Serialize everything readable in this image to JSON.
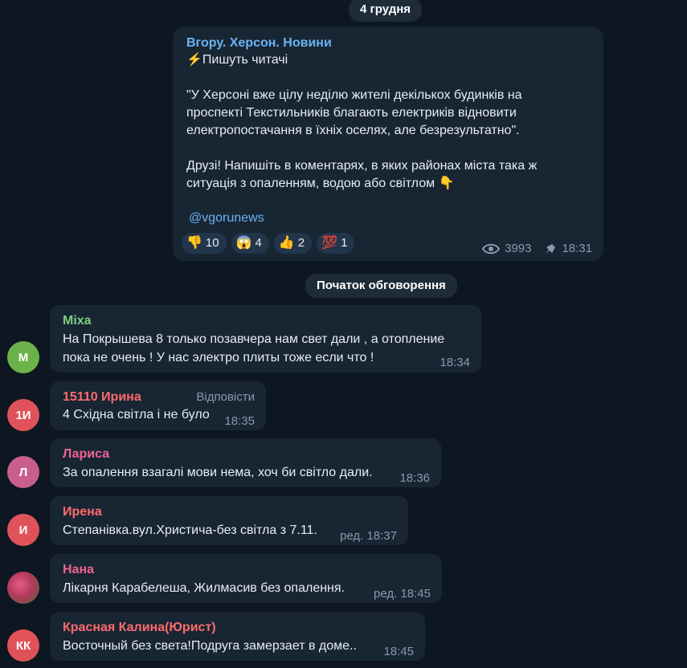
{
  "date_separator": "4 грудня",
  "channel_post": {
    "channel_name": "Вгору. Херсон. Новини",
    "line1": "⚡️Пишуть читачі",
    "paragraph1": "\"У Херсоні вже цілу неділю жителі декількох будинків на\nпроспекті Текстильників благають електриків відновити\nелектропостачання в їхніх оселях, але безрезультатно\".",
    "paragraph2": "Друзі! Напишіть в коментарях, в яких районах міста така ж\nситуація з опаленням, водою або світлом 👇",
    "handle": "@vgorunews",
    "reactions": [
      {
        "emoji": "👎",
        "count": "10"
      },
      {
        "emoji": "😱",
        "count": "4"
      },
      {
        "emoji": "👍",
        "count": "2"
      },
      {
        "emoji": "💯",
        "count": "1"
      }
    ],
    "views": "3993",
    "time": "18:31"
  },
  "discussion_label": "Початок обговорення",
  "comments": [
    {
      "initials": "М",
      "avatar_color": "#6cb24a",
      "name": "Міха",
      "name_color": "#7fd17f",
      "text": "На Покрышева 8 только позавчера нам свет дали , а отопление\nпока не очень ! У нас электро плиты тоже если что !",
      "time": "18:34"
    },
    {
      "initials": "1И",
      "avatar_color": "#e0525a",
      "name": "15110 Ирина",
      "name_color": "#ff6b6b",
      "reply": "Відповісти",
      "text": "4 Східна світла і не було",
      "time": "18:35"
    },
    {
      "initials": "Л",
      "avatar_color": "#c85e8d",
      "name": "Лариса",
      "name_color": "#f06292",
      "text": "За опалення взагалі мови нема, хоч би світло дали.",
      "time": "18:36"
    },
    {
      "initials": "И",
      "avatar_color": "#e0525a",
      "name": "Ирена",
      "name_color": "#ff6b6b",
      "text": "Степанівка.вул.Христича-без світла з 7.11.",
      "time": "ред. 18:37"
    },
    {
      "initials": "",
      "avatar_color": "#b23a5a",
      "name": "Нана",
      "name_color": "#f06292",
      "text": "Лікарня Карабелеша, Жилмасив без опалення.",
      "time": "ред. 18:45"
    },
    {
      "initials": "КК",
      "avatar_color": "#e0525a",
      "name": "Красная Калина(Юрист)",
      "name_color": "#ff6b6b",
      "text": "Восточный без света!Подруга замерзает в доме..",
      "time": "18:45"
    }
  ]
}
